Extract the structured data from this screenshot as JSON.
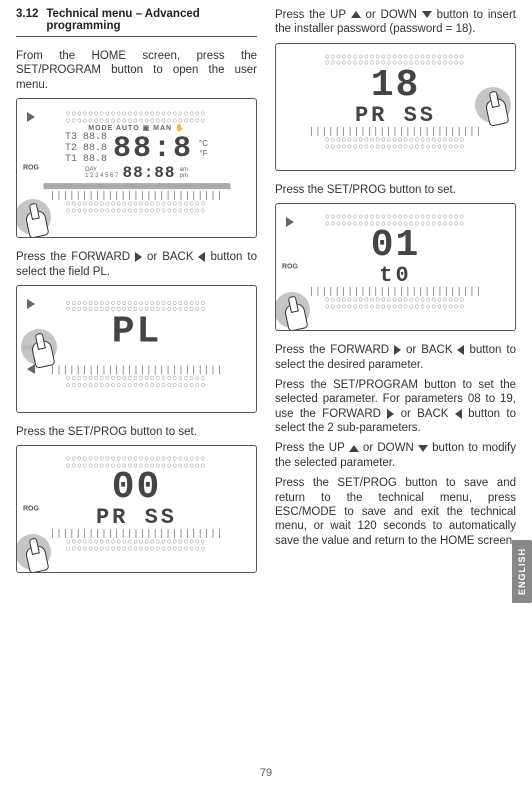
{
  "section": {
    "number": "3.12",
    "title": "Technical menu – Advanced programming"
  },
  "left": {
    "p1": "From the HOME screen, press the SET/PROGRAM button to open the user menu.",
    "fig1": {
      "mode": "MODE  AUTO ▣ MAN ✋",
      "t3": "T3 88.8",
      "t2": "T2 88.8",
      "t1": "T1 88.8",
      "big": "88:8",
      "unitc": "°C",
      "unitf": "°F",
      "day": "DAY",
      "daynums": "1 2 3 4 5 6 7",
      "clock": "88:88",
      "ampm": "am\npm"
    },
    "p2a": "Press the FORWARD ",
    "p2b": " or BACK ",
    "p2c": " button to select the field PL.",
    "fig2": {
      "big": "PL"
    },
    "p3": "Press the SET/PROG button to set.",
    "fig3": {
      "big": "00",
      "mid": "PR SS"
    }
  },
  "right": {
    "p1a": "Press the UP ",
    "p1b": " or DOWN ",
    "p1c": " button to insert the installer password (password = 18).",
    "fig4": {
      "big": "18",
      "mid": "PR SS"
    },
    "p2": "Press the SET/PROG button to set.",
    "fig5": {
      "big": "01",
      "mid": "t0"
    },
    "p3a": "Press the FORWARD ",
    "p3b": " or BACK ",
    "p3c": " button to select the desired parameter.",
    "p4a": "Press the SET/PROGRAM button to set the selected parameter. For parameters 08 to 19, use the FORWARD ",
    "p4b": " or BACK ",
    "p4c": " button to select the 2 sub-parameters.",
    "p5a": "Press the UP ",
    "p5b": " or DOWN ",
    "p5c": " button to modify the selected parameter.",
    "p6": "Press the SET/PROG button to save and return to the technical menu, press ESC/MODE to save and exit the technical menu, or wait 120 seconds to automatically save the value and return to the HOME screen."
  },
  "sidetab": "ENGLISH",
  "page": "79"
}
